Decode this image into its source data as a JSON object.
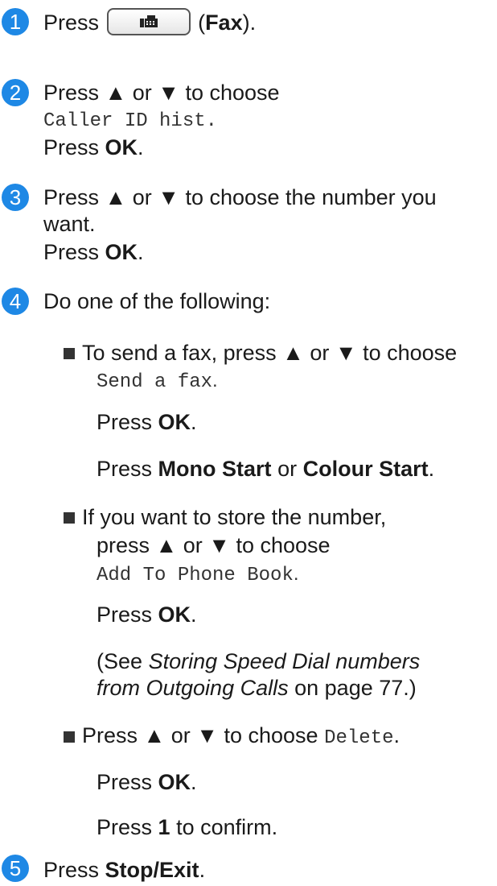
{
  "steps": [
    {
      "num": "1",
      "press": "Press",
      "paren_open": "(",
      "key": "Fax",
      "paren_close": ")."
    },
    {
      "num": "2",
      "line1": "Press ▲ or ▼ to choose",
      "menu": "Caller ID hist.",
      "press": "Press",
      "ok": "OK",
      "dot": "."
    },
    {
      "num": "3",
      "line1": "Press ▲ or ▼ to choose the number you",
      "line2": "want.",
      "press": "Press",
      "ok": "OK",
      "dot": "."
    },
    {
      "num": "4",
      "line1": "Do one of the following:"
    },
    {
      "num": "5",
      "press": "Press",
      "key": "Stop/Exit",
      "dot": "."
    }
  ],
  "options": [
    {
      "text": "To send a fax, press ▲ or ▼ to choose",
      "menu": "Send a fax",
      "press_ok": "Press",
      "ok": "OK",
      "dot": ".",
      "press2": "Press",
      "mono_start": "Mono Start",
      "or": "or",
      "colour_start": "Colour Start",
      "dot2": "."
    },
    {
      "line1": "If you want to store the number,",
      "line2": "press ▲ or ▼ to choose",
      "menu": "Add To Phone Book",
      "press_ok": "Press",
      "ok": "OK",
      "dot": ".",
      "see_open": "(See",
      "see_italic1": "Storing Speed Dial numbers",
      "see_italic2": "from Outgoing Calls",
      "see_close": "on page 77.)"
    },
    {
      "text": "Press ▲ or ▼ to choose",
      "menu": "Delete",
      "press_ok": "Press",
      "ok": "OK",
      "dot": ".",
      "press1": "Press",
      "one": "1",
      "confirm": "to confirm."
    }
  ],
  "colors": {
    "badge": "#1e88e5"
  },
  "icons": {
    "fax_key": "fax-icon",
    "bullet": "square-bullet-icon"
  }
}
